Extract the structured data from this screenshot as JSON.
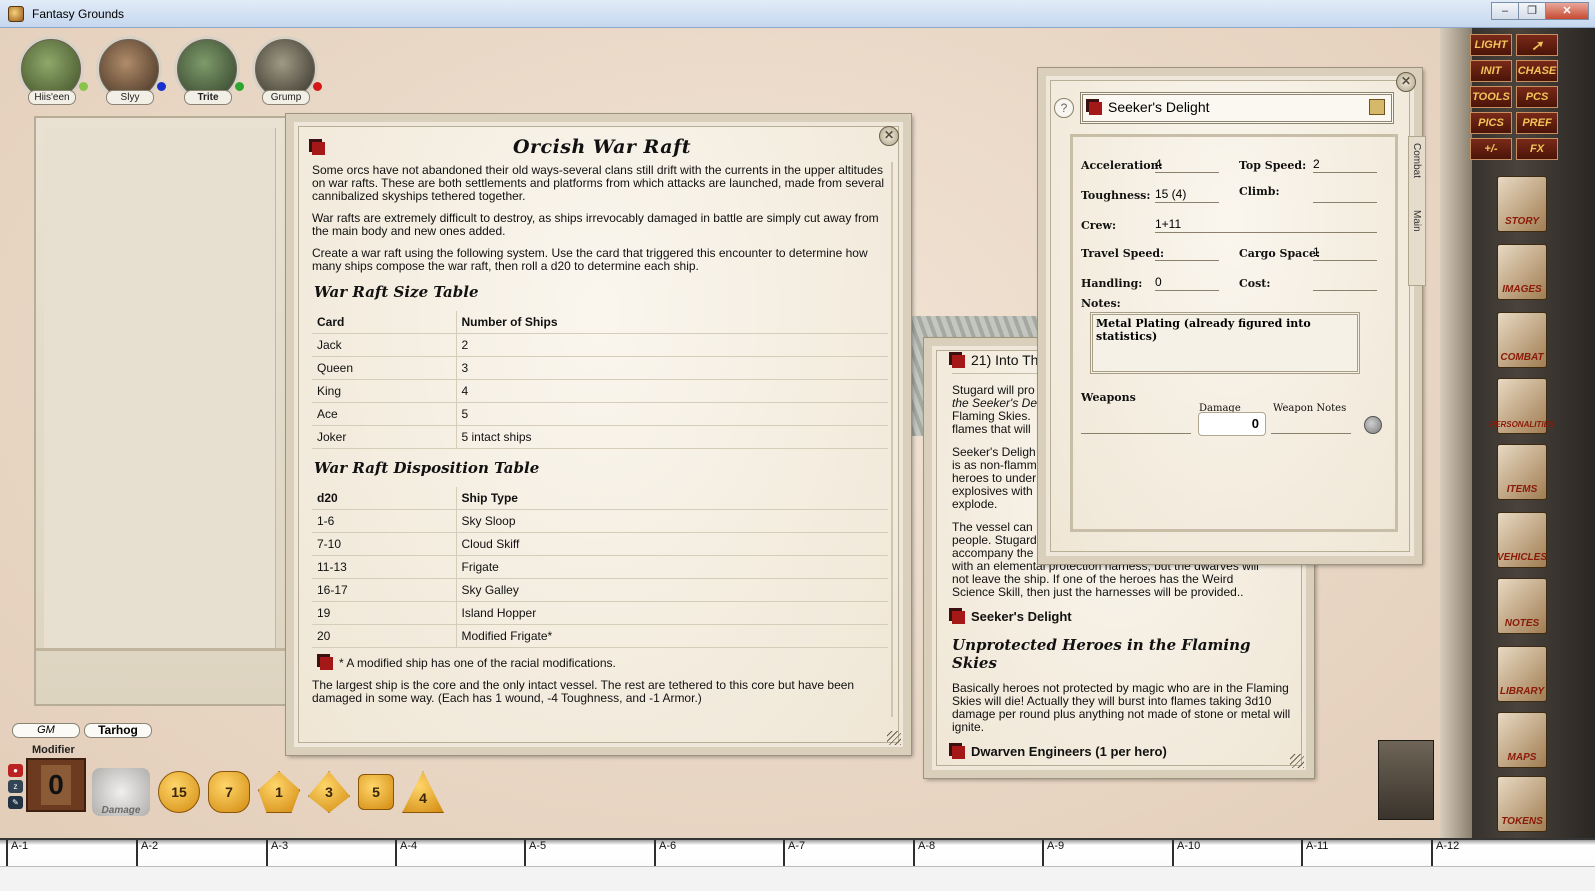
{
  "window": {
    "title": "Fantasy Grounds",
    "buttons": [
      "–",
      "❐",
      "✕"
    ]
  },
  "portraits": [
    {
      "name": "Hiis'een",
      "dot": "#88c34a"
    },
    {
      "name": "Slyy",
      "dot": "#1a2fd0"
    },
    {
      "name": "Trite",
      "dot": "#2ea52e"
    },
    {
      "name": "Grump",
      "dot": "#d41818"
    }
  ],
  "chat": {
    "gm_label": "GM",
    "user_label": "Tarhog",
    "modifier_label": "Modifier",
    "modifier_value": "0"
  },
  "dice": {
    "damage_label": "Damage",
    "d20": "15",
    "d12": "7",
    "d10": "1",
    "d8": "3",
    "d6": "5",
    "d4": "4"
  },
  "sidebar": {
    "buttons": [
      "LIGHT",
      "INIT",
      "CHASE",
      "TOOLS",
      "PCS",
      "PICS",
      "PREF",
      "+/-",
      "FX"
    ],
    "books": [
      "STORY",
      "IMAGES",
      "COMBAT",
      "PERSONALITIES",
      "ITEMS",
      "VEHICLES",
      "NOTES",
      "LIBRARY",
      "MAPS",
      "TOKENS"
    ]
  },
  "hotbar": [
    "A-1",
    "A-2",
    "A-3",
    "A-4",
    "A-5",
    "A-6",
    "A-7",
    "A-8",
    "A-9",
    "A-10",
    "A-11",
    "A-12"
  ],
  "raft": {
    "title": "Orcish War Raft",
    "p1": "Some orcs have not abandoned their old ways-several clans still drift with the currents in the upper altitudes on war rafts. These are both settlements and platforms from which attacks are launched, made from several cannibalized skyships tethered together.",
    "p2": "War rafts are extremely difficult to destroy, as ships irrevocably damaged in battle are simply cut away from the main body and new ones added.",
    "p3": "Create a war raft using the following system. Use the card that triggered this encounter to determine how many ships compose the war raft, then roll a d20 to determine each ship.",
    "size_heading": "War Raft Size Table",
    "size_table": [
      [
        "Card",
        "Number of Ships"
      ],
      [
        "Jack",
        "2"
      ],
      [
        "Queen",
        "3"
      ],
      [
        "King",
        "4"
      ],
      [
        "Ace",
        "5"
      ],
      [
        "Joker",
        "5 intact ships"
      ]
    ],
    "disp_heading": "War Raft Disposition Table",
    "disp_table": [
      [
        "d20",
        "Ship Type"
      ],
      [
        "1-6",
        "Sky Sloop"
      ],
      [
        "7-10",
        "Cloud Skiff"
      ],
      [
        "11-13",
        "Frigate"
      ],
      [
        "16-17",
        "Sky Galley"
      ],
      [
        "19",
        "Island Hopper"
      ],
      [
        "20",
        "Modified Frigate*"
      ]
    ],
    "footnote": "* A modified ship has one of the racial modifications.",
    "p4": "The largest ship is the core and the only intact vessel. The rest are tethered to this core but have been damaged in some way. (Each has 1 wound, -4 Toughness, and -1 Armor.)"
  },
  "story": {
    "title": "21) Into Th",
    "p1a": "Stugard will pro",
    "p1b": "the Seeker's De",
    "p1c": "Flaming Skies.",
    "p1d": "flames that will",
    "p2a": "Seeker's Deligh",
    "p2b": "is as non-flamm",
    "p2c": "heroes to under",
    "p2d": "explosives with",
    "p2e": "explode.",
    "p3a": "The vessel can",
    "p3b": "people. Stugard",
    "p3c": "accompany the",
    "p3d": "with an elemental protection harness, but the dwarves will",
    "p3e": "not leave the ship. If one of the heroes has the Weird",
    "p3f": "Science Skill, then just the harnesses will be provided..",
    "link1": "Seeker's Delight",
    "heading": "Unprotected Heroes in the Flaming Skies",
    "p4": "Basically heroes not protected by magic who are in the Flaming Skies will die! Actually they will burst into flames taking 3d10 damage per round plus anything not made of stone or metal will ignite.",
    "link2": "Dwarven Engineers (1 per hero)"
  },
  "vehicle": {
    "name": "Seeker's Delight",
    "acceleration_label": "Acceleration:",
    "acceleration": "4",
    "top_speed_label": "Top Speed:",
    "top_speed": "2",
    "toughness_label": "Toughness:",
    "toughness": "15  (4)",
    "climb_label": "Climb:",
    "climb": "",
    "crew_label": "Crew:",
    "crew": "1+11",
    "travel_speed_label": "Travel Speed:",
    "travel_speed": "",
    "cargo_label": "Cargo Space:",
    "cargo": "1",
    "handling_label": "Handling:",
    "handling": "0",
    "cost_label": "Cost:",
    "cost": "",
    "notes_label": "Notes:",
    "notes": "Metal Plating (already figured into statistics)",
    "weapons_label": "Weapons",
    "damage_label": "Damage",
    "weapon_notes_label": "Weapon Notes",
    "damage_value": "0",
    "tabs": [
      "Combat",
      "Main"
    ]
  }
}
